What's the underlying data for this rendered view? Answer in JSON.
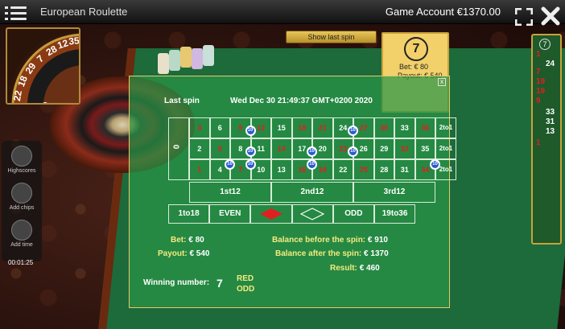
{
  "app": {
    "title": "European Roulette",
    "account": "Game Account €1370.00"
  },
  "wheel_thumb": {
    "numbers": [
      "22",
      "18",
      "29",
      "7",
      "28",
      "12",
      "35"
    ]
  },
  "tools": {
    "highscores": "Highscores",
    "add_chips": "Add chips",
    "add_time": "Add time",
    "timer": "00:01:25"
  },
  "show_last_spin": "Show last spin",
  "result_panel": {
    "number": "7",
    "bet": "Bet: € 80",
    "payout": "Payout: € 540"
  },
  "history": {
    "top": "7",
    "items": [
      {
        "value": "1",
        "color": "#e02020"
      },
      {
        "value": "24",
        "color": "#ffffff"
      },
      {
        "value": "7",
        "color": "#e02020"
      },
      {
        "value": "19",
        "color": "#e02020"
      },
      {
        "value": "19",
        "color": "#e02020"
      },
      {
        "value": "9",
        "color": "#e02020"
      },
      {
        "value": "33",
        "color": "#ffffff"
      },
      {
        "value": "31",
        "color": "#ffffff"
      },
      {
        "value": "13",
        "color": "#ffffff"
      },
      {
        "value": "1",
        "color": "#e02020"
      }
    ]
  },
  "dialog": {
    "title": "Last spin",
    "date": "Wed Dec 30 21:49:37 GMT+0200 2020",
    "close": "x",
    "zero": "0",
    "rows": [
      [
        "3",
        "6",
        "9",
        "12",
        "15",
        "18",
        "21",
        "24",
        "27",
        "30",
        "33",
        "36"
      ],
      [
        "2",
        "5",
        "8",
        "11",
        "14",
        "17",
        "20",
        "23",
        "26",
        "29",
        "32",
        "35"
      ],
      [
        "1",
        "4",
        "7",
        "10",
        "13",
        "16",
        "19",
        "22",
        "25",
        "28",
        "31",
        "34"
      ]
    ],
    "red_numbers": [
      "1",
      "3",
      "5",
      "7",
      "9",
      "12",
      "14",
      "16",
      "18",
      "19",
      "21",
      "23",
      "25",
      "27",
      "30",
      "32",
      "34",
      "36"
    ],
    "column_bets": [
      "2to1",
      "2to1",
      "2to1"
    ],
    "chip_value": "10",
    "dozens": [
      "1st12",
      "2nd12",
      "3rd12"
    ],
    "outside": [
      "1to18",
      "EVEN",
      "",
      "",
      "ODD",
      "19to36"
    ],
    "bet_label": "Bet:",
    "bet_value": "€ 80",
    "payout_label": "Payout:",
    "payout_value": "€ 540",
    "balance_before_label": "Balance before the spin:",
    "balance_before_value": "€ 910",
    "balance_after_label": "Balance after the spin:",
    "balance_after_value": "€ 1370",
    "result_label": "Result:",
    "result_value": "€ 460",
    "winning_label": "Winning number:",
    "winning_number": "7",
    "winning_color": "RED",
    "winning_parity": "ODD"
  }
}
